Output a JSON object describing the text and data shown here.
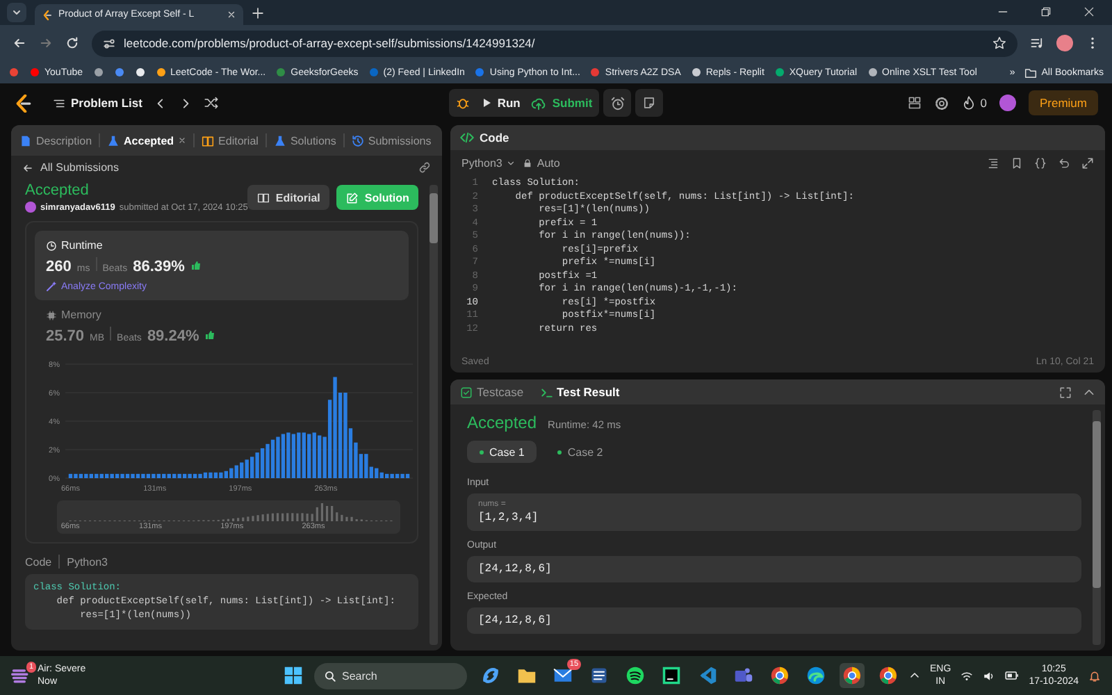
{
  "browser": {
    "tab": {
      "title": "Product of Array Except Self - L"
    },
    "url": "leetcode.com/problems/product-of-array-except-self/submissions/1424991324/",
    "bookmarks": [
      {
        "kind": "icon",
        "color": "#ea4335"
      },
      {
        "kind": "link",
        "label": "YouTube",
        "color": "#ff0000"
      },
      {
        "kind": "icon",
        "color": "#9aa0a6"
      },
      {
        "kind": "icon",
        "color": "#4a8af4"
      },
      {
        "kind": "icon",
        "color": "#e8eaed"
      },
      {
        "kind": "link",
        "label": "LeetCode - The Wor...",
        "color": "#ffa116"
      },
      {
        "kind": "link",
        "label": "GeeksforGeeks",
        "color": "#2f8d46"
      },
      {
        "kind": "link",
        "label": "(2) Feed | LinkedIn",
        "color": "#0a66c2"
      },
      {
        "kind": "link",
        "label": "Using Python to Int...",
        "color": "#1a73e8"
      },
      {
        "kind": "link",
        "label": "Strivers A2Z DSA",
        "color": "#e53935"
      },
      {
        "kind": "link",
        "label": "Repls - Replit",
        "color": "#c8cbd0"
      },
      {
        "kind": "link",
        "label": "XQuery Tutorial",
        "color": "#04aa6d"
      },
      {
        "kind": "link",
        "label": "Online XSLT Test Tool",
        "color": "#b0b4ba"
      }
    ],
    "more": "»",
    "all_bookmarks": "All Bookmarks"
  },
  "leetcode_bar": {
    "problem_list": "Problem List",
    "run": "Run",
    "submit": "Submit",
    "streak": "0",
    "premium": "Premium"
  },
  "submission_panel": {
    "tabs": [
      {
        "label": "Description",
        "kind": "description",
        "selected": false,
        "closable": false
      },
      {
        "label": "Accepted",
        "kind": "result",
        "selected": true,
        "closable": true
      },
      {
        "label": "Editorial",
        "kind": "editorial",
        "selected": false,
        "closable": false
      },
      {
        "label": "Solutions",
        "kind": "solutions",
        "selected": false,
        "closable": false
      },
      {
        "label": "Submissions",
        "kind": "submissions",
        "selected": false,
        "closable": false
      }
    ],
    "back_link": "All Submissions",
    "status": "Accepted",
    "user": "simranyadav6119",
    "submitted": "submitted at Oct 17, 2024 10:25",
    "buttons": [
      {
        "label": "Editorial",
        "kind": "secondary"
      },
      {
        "label": "Solution",
        "kind": "primary"
      }
    ],
    "metrics": [
      {
        "kind": "runtime",
        "title": "Runtime",
        "value": "260",
        "unit": "ms",
        "beats_label": "Beats",
        "beats": "86.39%",
        "link": "Analyze Complexity",
        "selected": true
      },
      {
        "kind": "memory",
        "title": "Memory",
        "value": "25.70",
        "unit": "MB",
        "beats_label": "Beats",
        "beats": "89.24%",
        "selected": false
      }
    ],
    "chart_data": {
      "type": "bar",
      "xlim": [
        62,
        330
      ],
      "ylim": [
        0,
        8
      ],
      "xticks": [
        {
          "value": 66,
          "label": "66ms"
        },
        {
          "value": 131,
          "label": "131ms"
        },
        {
          "value": 197,
          "label": "197ms"
        },
        {
          "value": 263,
          "label": "263ms"
        }
      ],
      "yticks": [
        {
          "value": 0,
          "label": "0%"
        },
        {
          "value": 2,
          "label": "2%"
        },
        {
          "value": 4,
          "label": "4%"
        },
        {
          "value": 6,
          "label": "6%"
        },
        {
          "value": 8,
          "label": "8%"
        }
      ],
      "x": [
        66,
        70,
        74,
        78,
        82,
        86,
        90,
        94,
        98,
        102,
        106,
        110,
        114,
        118,
        122,
        126,
        130,
        134,
        138,
        142,
        146,
        150,
        154,
        158,
        162,
        166,
        170,
        174,
        178,
        182,
        186,
        190,
        194,
        198,
        202,
        206,
        210,
        214,
        218,
        222,
        226,
        230,
        234,
        238,
        242,
        246,
        250,
        254,
        258,
        262,
        266,
        270,
        274,
        278,
        282,
        286,
        290,
        294,
        298,
        302,
        306,
        310,
        314,
        318,
        322,
        326
      ],
      "series": [
        {
          "color": "#2a7de1",
          "values": [
            0.3,
            0.3,
            0.3,
            0.3,
            0.3,
            0.3,
            0.3,
            0.3,
            0.3,
            0.3,
            0.3,
            0.3,
            0.3,
            0.3,
            0.3,
            0.3,
            0.3,
            0.3,
            0.3,
            0.3,
            0.3,
            0.3,
            0.3,
            0.3,
            0.3,
            0.3,
            0.4,
            0.4,
            0.4,
            0.4,
            0.5,
            0.7,
            0.9,
            1.1,
            1.3,
            1.5,
            1.8,
            2.1,
            2.4,
            2.7,
            2.9,
            3.1,
            3.2,
            3.1,
            3.2,
            3.2,
            3.1,
            3.2,
            3.0,
            2.9,
            5.5,
            7.1,
            6.0,
            6.0,
            3.5,
            2.5,
            1.7,
            1.7,
            0.8,
            0.7,
            0.4,
            0.3,
            0.3,
            0.3,
            0.3,
            0.3
          ]
        }
      ],
      "grid": true
    },
    "overview_labels": [
      "66ms",
      "131ms",
      "197ms",
      "263ms"
    ],
    "code_label": "Code",
    "language": "Python3",
    "code_preview": [
      "class Solution:",
      "    def productExceptSelf(self, nums: List[int]) -> List[int]:",
      "        res=[1]*(len(nums))"
    ]
  },
  "editor": {
    "title": "Code",
    "language": "Python3",
    "mode": "Auto",
    "lines": [
      {
        "number": "1",
        "text": "class Solution:",
        "current": false
      },
      {
        "number": "2",
        "text": "    def productExceptSelf(self, nums: List[int]) -> List[int]:",
        "current": false
      },
      {
        "number": "3",
        "text": "        res=[1]*(len(nums))",
        "current": false
      },
      {
        "number": "4",
        "text": "        prefix = 1",
        "current": false
      },
      {
        "number": "5",
        "text": "        for i in range(len(nums)):",
        "current": false
      },
      {
        "number": "6",
        "text": "            res[i]=prefix",
        "current": false
      },
      {
        "number": "7",
        "text": "            prefix *=nums[i]",
        "current": false
      },
      {
        "number": "8",
        "text": "        postfix =1",
        "current": false
      },
      {
        "number": "9",
        "text": "        for i in range(len(nums)-1,-1,-1):",
        "current": false
      },
      {
        "number": "10",
        "text": "            res[i] *=postfix",
        "current": true
      },
      {
        "number": "11",
        "text": "            postfix*=nums[i]",
        "current": false
      },
      {
        "number": "12",
        "text": "        return res",
        "current": false
      }
    ],
    "status": "Saved",
    "cursor": "Ln 10, Col 21"
  },
  "test_result": {
    "tabs": [
      {
        "label": "Testcase",
        "kind": "testcase",
        "selected": false
      },
      {
        "label": "Test Result",
        "kind": "result",
        "selected": true
      }
    ],
    "status": "Accepted",
    "runtime": "Runtime: 42 ms",
    "cases": [
      {
        "label": "Case 1",
        "selected": true
      },
      {
        "label": "Case 2",
        "selected": false
      }
    ],
    "sections": [
      {
        "label": "Input",
        "param": "nums =",
        "value": "[1,2,3,4]"
      },
      {
        "label": "Output",
        "value": "[24,12,8,6]"
      },
      {
        "label": "Expected",
        "value": "[24,12,8,6]"
      }
    ]
  },
  "taskbar": {
    "weather": {
      "title": "Air: Severe",
      "subtitle": "Now",
      "badge": "1"
    },
    "search": {
      "placeholder": "Search"
    },
    "apps": [
      {
        "kind": "copilot",
        "selected": false
      },
      {
        "kind": "folder",
        "selected": false
      },
      {
        "kind": "mail",
        "badge": "15",
        "selected": false
      },
      {
        "kind": "word",
        "selected": false
      },
      {
        "kind": "spotify",
        "selected": false
      },
      {
        "kind": "pycharm",
        "selected": false
      },
      {
        "kind": "vscode",
        "selected": false
      },
      {
        "kind": "teams",
        "selected": false
      },
      {
        "kind": "chrome",
        "selected": false
      },
      {
        "kind": "edge",
        "selected": false
      },
      {
        "kind": "chrome",
        "selected": true
      },
      {
        "kind": "chrome",
        "selected": false
      }
    ],
    "language": "ENG",
    "region": "IN",
    "time": "10:25",
    "date": "17-10-2024"
  }
}
